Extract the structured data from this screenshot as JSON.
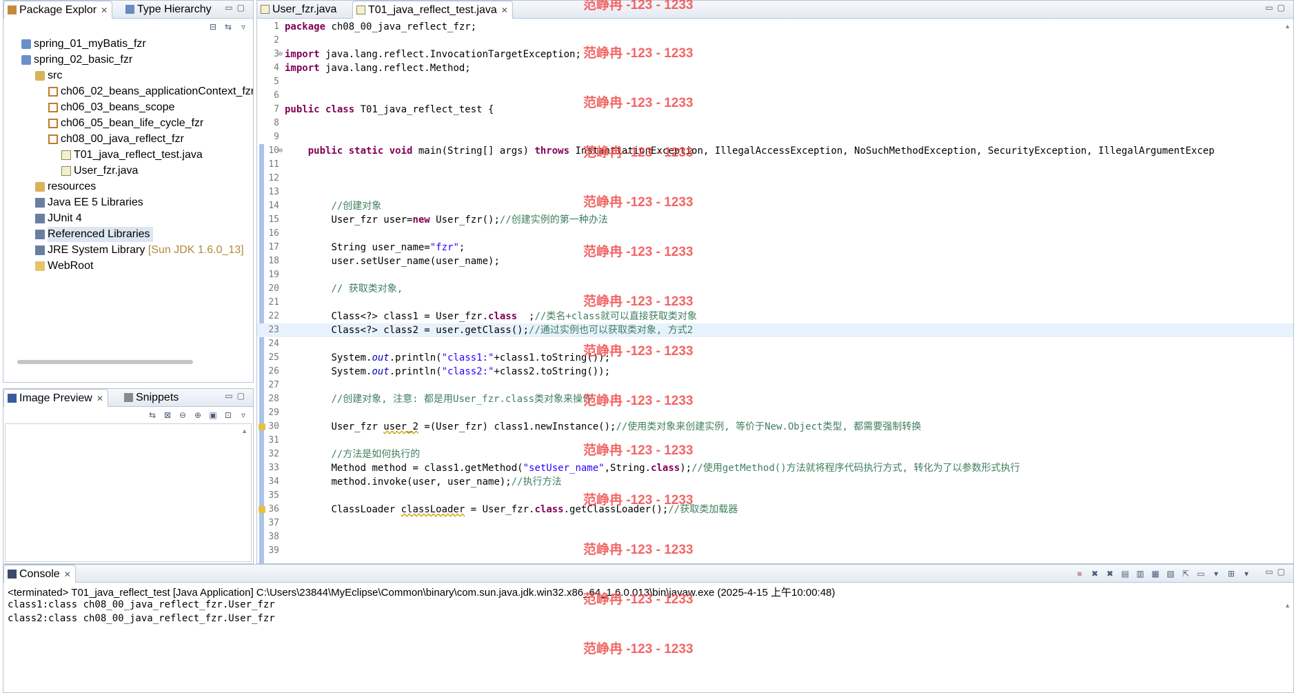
{
  "package_explorer": {
    "tabs": [
      {
        "label": "Package Explor",
        "close": "✕"
      },
      {
        "label": "Type Hierarchy"
      }
    ],
    "items": [
      {
        "label": "spring_01_myBatis_fzr",
        "icon": "project-icon"
      },
      {
        "label": "spring_02_basic_fzr",
        "icon": "project-icon"
      },
      {
        "label": "src",
        "icon": "source-folder-icon"
      },
      {
        "label": "ch06_02_beans_applicationContext_fzr",
        "icon": "package-icon"
      },
      {
        "label": "ch06_03_beans_scope",
        "icon": "package-icon"
      },
      {
        "label": "ch06_05_bean_life_cycle_fzr",
        "icon": "package-icon"
      },
      {
        "label": "ch08_00_java_reflect_fzr",
        "icon": "package-icon"
      },
      {
        "label": "T01_java_reflect_test.java",
        "icon": "java-file-icon"
      },
      {
        "label": "User_fzr.java",
        "icon": "java-file-icon"
      },
      {
        "label": "resources",
        "icon": "source-folder-icon"
      },
      {
        "label": "Java EE 5 Libraries",
        "icon": "library-icon"
      },
      {
        "label": "JUnit 4",
        "icon": "library-icon"
      },
      {
        "label": "Referenced Libraries",
        "icon": "library-icon"
      },
      {
        "label": "JRE System Library",
        "decoration": "[Sun JDK 1.6.0_13]",
        "icon": "library-icon"
      },
      {
        "label": "WebRoot",
        "icon": "folder-icon"
      }
    ]
  },
  "image_preview": {
    "tabs": [
      {
        "label": "Image Preview",
        "close": "✕"
      },
      {
        "label": "Snippets"
      }
    ]
  },
  "editor": {
    "tabs": [
      {
        "label": "User_fzr.java"
      },
      {
        "label": "T01_java_reflect_test.java",
        "close": "✕"
      }
    ],
    "line_numbers": [
      "1",
      "2",
      "3",
      "4",
      "5",
      "6",
      "7",
      "8",
      "9",
      "10",
      "11",
      "12",
      "13",
      "14",
      "15",
      "16",
      "17",
      "18",
      "19",
      "20",
      "21",
      "22",
      "23",
      "24",
      "25",
      "26",
      "27",
      "28",
      "29",
      "30",
      "31",
      "32",
      "33",
      "34",
      "35",
      "36",
      "37",
      "38",
      "39"
    ],
    "code": {
      "l1_kw": "package",
      "l1_rest": " ch08_00_java_reflect_fzr;",
      "l3_kw": "import",
      "l3_rest": " java.lang.reflect.InvocationTargetException;",
      "l4_kw": "import",
      "l4_rest": " java.lang.reflect.Method;",
      "l7_kw": "public class",
      "l7_rest": " T01_java_reflect_test {",
      "l10_kw1": "public static void",
      "l10_mid": " main(String[] args) ",
      "l10_kw2": "throws",
      "l10_rest": " InstantiationException, IllegalAccessException, NoSuchMethodException, SecurityException, IllegalArgumentExcep",
      "l14_cm": "//创建对象",
      "l15_a": "User_fzr user=",
      "l15_kw": "new",
      "l15_b": " User_fzr();",
      "l15_cm": "//创建实例的第一种办法",
      "l17_a": "String user_name=",
      "l17_str": "\"fzr\"",
      "l17_b": ";",
      "l18": "user.setUser_name(user_name);",
      "l20_cm": "// 获取类对象,",
      "l22_a": "Class<?> class1 = User_fzr.",
      "l22_kw": "class",
      "l22_b": "  ;",
      "l22_cm": "//类名+class就可以直接获取类对象",
      "l23_a": "Class<?> class2 = user.getClass();",
      "l23_cm": "//通过实例也可以获取类对象, 方式2",
      "l25_a": "System.",
      "l25_fld": "out",
      "l25_b": ".println(",
      "l25_str": "\"class1:\"",
      "l25_c": "+class1.toString());",
      "l26_a": "System.",
      "l26_fld": "out",
      "l26_b": ".println(",
      "l26_str": "\"class2:\"",
      "l26_c": "+class2.toString());",
      "l28_cm": "//创建对象, 注意: 都是用User_fzr.class类对象来操作",
      "l30_a": "User_fzr ",
      "l30_warn": "user_2",
      "l30_b": " =(User_fzr) class1.newInstance();",
      "l30_cm": "//使用类对象来创建实例, 等价于New.Object类型, 都需要强制转换",
      "l32_cm": "//方法是如何执行的",
      "l33_a": "Method method = class1.getMethod(",
      "l33_str": "\"setUser_name\"",
      "l33_b": ",String.",
      "l33_kw": "class",
      "l33_c": ");",
      "l33_cm": "//使用getMethod()方法就将程序代码执行方式, 转化为了以参数形式执行",
      "l34_a": "method.invoke(user, user_name);",
      "l34_cm": "//执行方法",
      "l36_a": "ClassLoader ",
      "l36_warn": "classLoader",
      "l36_b": " = User_fzr.",
      "l36_kw": "class",
      "l36_c": ".getClassLoader();",
      "l36_cm": "//获取类加载器"
    }
  },
  "console": {
    "tab": {
      "label": "Console",
      "close": "✕"
    },
    "terminated": "<terminated> T01_java_reflect_test [Java Application] C:\\Users\\23844\\MyEclipse\\Common\\binary\\com.sun.java.jdk.win32.x86_64_1.6.0.013\\bin\\javaw.exe (2025-4-15 上午10:00:48)",
    "output": [
      "class1:class ch08_00_java_reflect_fzr.User_fzr",
      "class2:class ch08_00_java_reflect_fzr.User_fzr"
    ]
  },
  "watermark": "范峥冉 -123 - 1233",
  "colors": {
    "keyword": "#7f0055",
    "comment": "#3f7f5f",
    "string": "#2a00ff",
    "watermark": "#f24b4b",
    "selection": "#dde6f3",
    "current_line": "#e8f2fe"
  }
}
